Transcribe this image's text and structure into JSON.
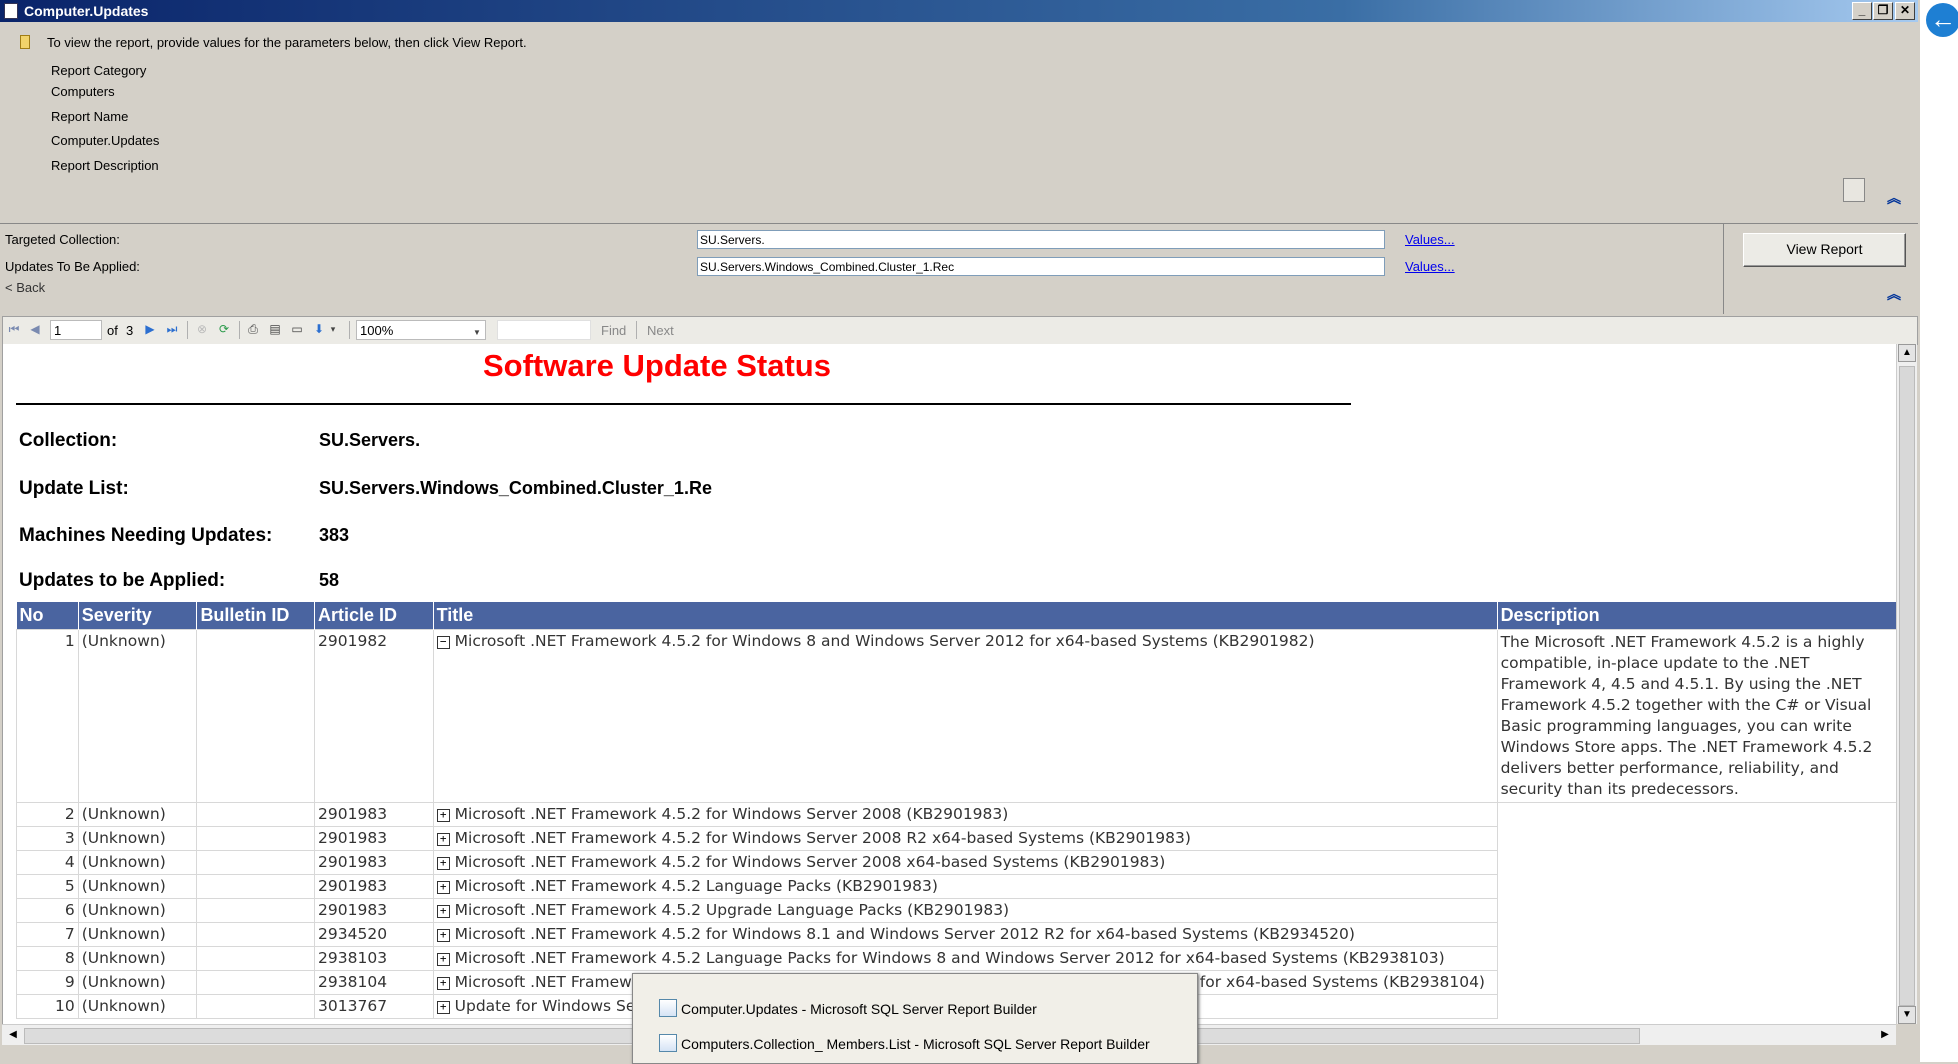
{
  "window": {
    "title": "Computer.Updates"
  },
  "info": {
    "instruction": "To view the report, provide values for the parameters below, then click View Report.",
    "report_category_label": "Report Category",
    "report_category_value": "Computers",
    "report_name_label": "Report Name",
    "report_name_value": "Computer.Updates",
    "report_description_label": "Report Description"
  },
  "params": {
    "targeted_collection_label": "Targeted Collection:",
    "targeted_collection_value": "SU.Servers.",
    "updates_label": "Updates To Be Applied:",
    "updates_value": "SU.Servers.Windows_Combined.Cluster_1.Rec",
    "values_link": "Values...",
    "back_label": "< Back",
    "view_report_button": "View Report"
  },
  "toolbar": {
    "page_current": "1",
    "page_of": "of",
    "page_total": "3",
    "zoom": "100%",
    "find_label": "Find",
    "next_label": "Next"
  },
  "report": {
    "title": "Software Update Status",
    "collection_label": "Collection:",
    "collection_value": "SU.Servers.",
    "update_list_label": "Update List:",
    "update_list_value": "SU.Servers.Windows_Combined.Cluster_1.Re",
    "machines_label": "Machines Needing Updates:",
    "machines_value": "383",
    "updates_label": "Updates to be Applied:",
    "updates_value": "58",
    "columns": [
      "No",
      "Severity",
      "Bulletin ID",
      "Article ID",
      "Title",
      "Description"
    ],
    "rows": [
      {
        "no": "1",
        "severity": "(Unknown)",
        "bulletin": "",
        "article": "2901982",
        "expander": "−",
        "title": "Microsoft .NET Framework 4.5.2 for Windows 8 and Windows Server 2012 for x64-based Systems (KB2901982)",
        "description": "The Microsoft .NET Framework 4.5.2 is a highly compatible, in-place update to the .NET Framework 4, 4.5 and 4.5.1. By using the .NET Framework 4.5.2 together with the C# or Visual Basic programming languages, you can write Windows Store apps. The .NET Framework 4.5.2 delivers better performance, reliability, and security than its predecessors."
      },
      {
        "no": "2",
        "severity": "(Unknown)",
        "bulletin": "",
        "article": "2901983",
        "expander": "+",
        "title": "Microsoft .NET Framework 4.5.2 for Windows Server 2008 (KB2901983)"
      },
      {
        "no": "3",
        "severity": "(Unknown)",
        "bulletin": "",
        "article": "2901983",
        "expander": "+",
        "title": "Microsoft .NET Framework 4.5.2 for Windows Server 2008 R2 x64-based Systems (KB2901983)"
      },
      {
        "no": "4",
        "severity": "(Unknown)",
        "bulletin": "",
        "article": "2901983",
        "expander": "+",
        "title": "Microsoft .NET Framework 4.5.2 for Windows Server 2008 x64-based Systems (KB2901983)"
      },
      {
        "no": "5",
        "severity": "(Unknown)",
        "bulletin": "",
        "article": "2901983",
        "expander": "+",
        "title": "Microsoft .NET Framework 4.5.2 Language Packs (KB2901983)"
      },
      {
        "no": "6",
        "severity": "(Unknown)",
        "bulletin": "",
        "article": "2901983",
        "expander": "+",
        "title": "Microsoft .NET Framework 4.5.2 Upgrade Language Packs (KB2901983)"
      },
      {
        "no": "7",
        "severity": "(Unknown)",
        "bulletin": "",
        "article": "2934520",
        "expander": "+",
        "title": "Microsoft .NET Framework 4.5.2 for Windows 8.1 and Windows Server 2012 R2 for x64-based Systems (KB2934520)"
      },
      {
        "no": "8",
        "severity": "(Unknown)",
        "bulletin": "",
        "article": "2938103",
        "expander": "+",
        "title": "Microsoft .NET Framework 4.5.2 Language Packs for Windows 8 and Windows Server 2012 for x64-based Systems (KB2938103)"
      },
      {
        "no": "9",
        "severity": "(Unknown)",
        "bulletin": "",
        "article": "2938104",
        "expander": "+",
        "title": "Microsoft .NET Framework 4.5.2 Language Packs for Windows 8.1 and Windows Server 2012 R2 for x64-based Systems (KB2938104)"
      },
      {
        "no": "10",
        "severity": "(Unknown)",
        "bulletin": "",
        "article": "3013767",
        "expander": "+",
        "title": "Update for Windows Se"
      }
    ]
  },
  "taskbar_popup": {
    "items": [
      "Computer.Updates - Microsoft SQL Server Report Builder",
      "Computers.Collection_ Members.List - Microsoft SQL Server Report Builder"
    ]
  }
}
